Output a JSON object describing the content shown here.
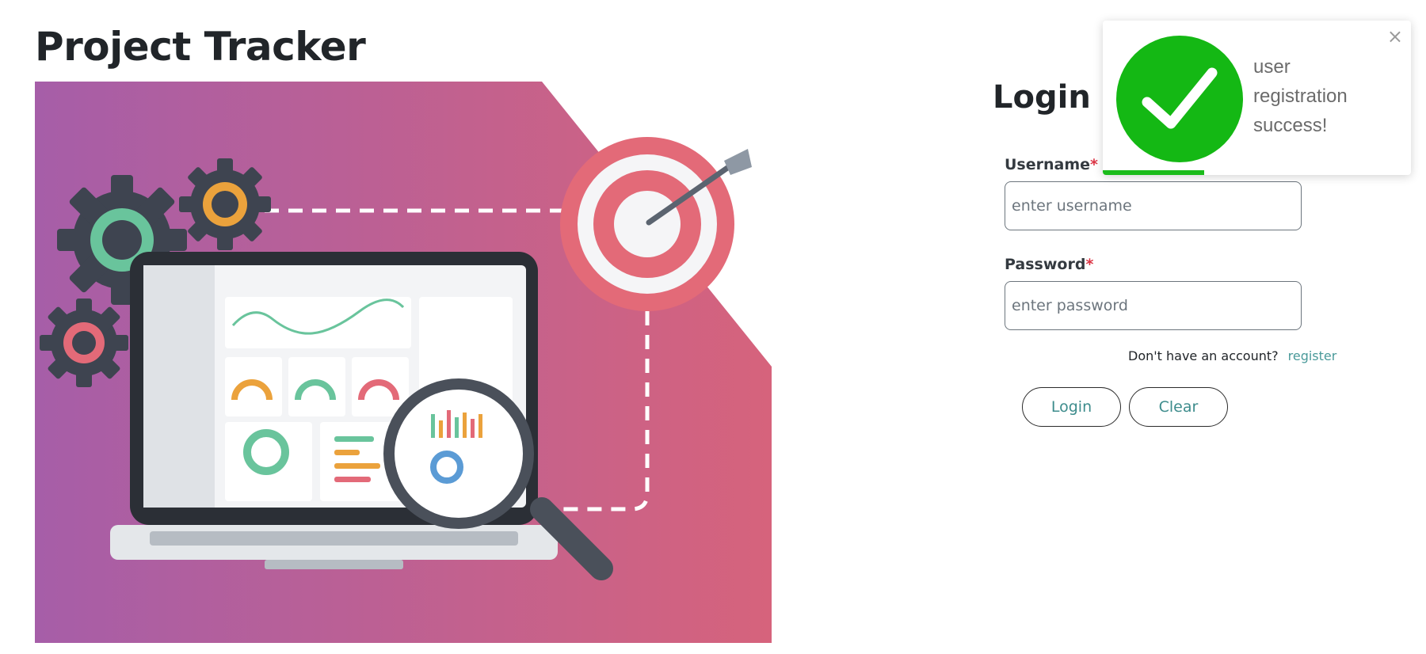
{
  "app": {
    "title": "Project Tracker"
  },
  "login": {
    "title": "Login",
    "username_label": "Username",
    "username_placeholder": "enter username",
    "password_label": "Password",
    "password_placeholder": "enter password",
    "required_mark": "*",
    "no_account_text": "Don't have an account?",
    "register_link": "register",
    "login_button": "Login",
    "clear_button": "Clear"
  },
  "toast": {
    "message": "user registration success!",
    "close_symbol": "×",
    "icon": "check-circle-icon",
    "progress_fraction": 0.33,
    "color": "#14b814"
  },
  "colors": {
    "hero_gradient_start": "#a65ea8",
    "hero_gradient_end": "#d6637c",
    "target_red": "#e36a78",
    "link": "#4a9a9a"
  }
}
